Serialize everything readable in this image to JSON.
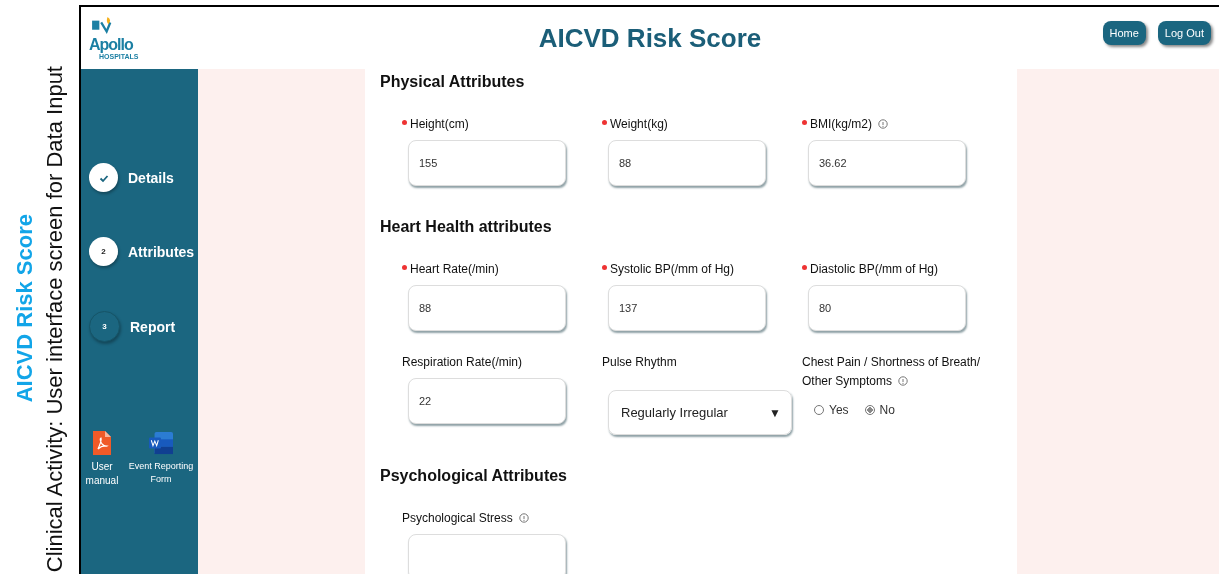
{
  "caption": {
    "title": "AICVD Risk Score",
    "subtitle": "Clinical Activity: User interface screen for Data Input"
  },
  "logo": {
    "name": "Apollo",
    "sub": "HOSPITALS"
  },
  "header": {
    "title": "AICVD Risk Score",
    "buttons": [
      "Home",
      "Log Out"
    ]
  },
  "steps": [
    {
      "kind": "done",
      "label": "Details"
    },
    {
      "kind": "current",
      "number": "2",
      "label": "Attributes"
    },
    {
      "kind": "pending",
      "number": "3",
      "label": "Report"
    }
  ],
  "resources": [
    {
      "kind": "pdf",
      "label": "User manual"
    },
    {
      "kind": "word",
      "label": "Event Reporting Form"
    }
  ],
  "sections": [
    {
      "title": "Physical Attributes",
      "fields": [
        {
          "kind": "input",
          "label": "Height(cm)",
          "required": true,
          "info": false,
          "value": "155"
        },
        {
          "kind": "input",
          "label": "Weight(kg)",
          "required": true,
          "info": false,
          "value": "88"
        },
        {
          "kind": "input",
          "label": "BMI(kg/m2)",
          "required": true,
          "info": true,
          "value": "36.62"
        }
      ]
    },
    {
      "title": "Heart Health attributes",
      "fields": [
        {
          "kind": "input",
          "label": "Heart Rate(/min)",
          "required": true,
          "info": false,
          "value": "88"
        },
        {
          "kind": "input",
          "label": "Systolic BP(/mm of Hg)",
          "required": true,
          "info": false,
          "value": "137"
        },
        {
          "kind": "input",
          "label": "Diastolic BP(/mm of Hg)",
          "required": true,
          "info": false,
          "value": "80"
        },
        {
          "kind": "input",
          "label": "Respiration Rate(/min)",
          "required": false,
          "info": false,
          "value": "22"
        },
        {
          "kind": "select",
          "label": "Pulse Rhythm",
          "required": false,
          "info": false,
          "value": "Regularly Irregular",
          "arrow": "▼"
        },
        {
          "kind": "radio",
          "label": "Chest Pain / Shortness of Breath/ Other Symptoms",
          "required": false,
          "info": true,
          "options": [
            {
              "label": "Yes",
              "selected": false
            },
            {
              "label": "No",
              "selected": true
            }
          ]
        }
      ]
    },
    {
      "title": "Psychological Attributes",
      "fields": [
        {
          "kind": "input",
          "label": "Psychological Stress",
          "required": false,
          "info": true
        }
      ]
    }
  ]
}
